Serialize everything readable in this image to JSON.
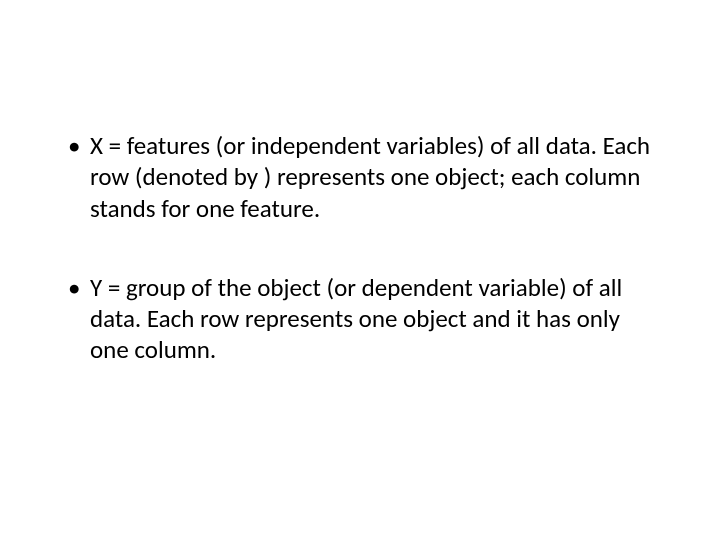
{
  "bullets": [
    {
      "text": "X = features (or independent variables) of all data. Each row (denoted by ) represents one object; each column stands for one feature."
    },
    {
      "text": "Y = group of the object (or dependent variable) of all data. Each row represents one object and it has only one column."
    }
  ]
}
